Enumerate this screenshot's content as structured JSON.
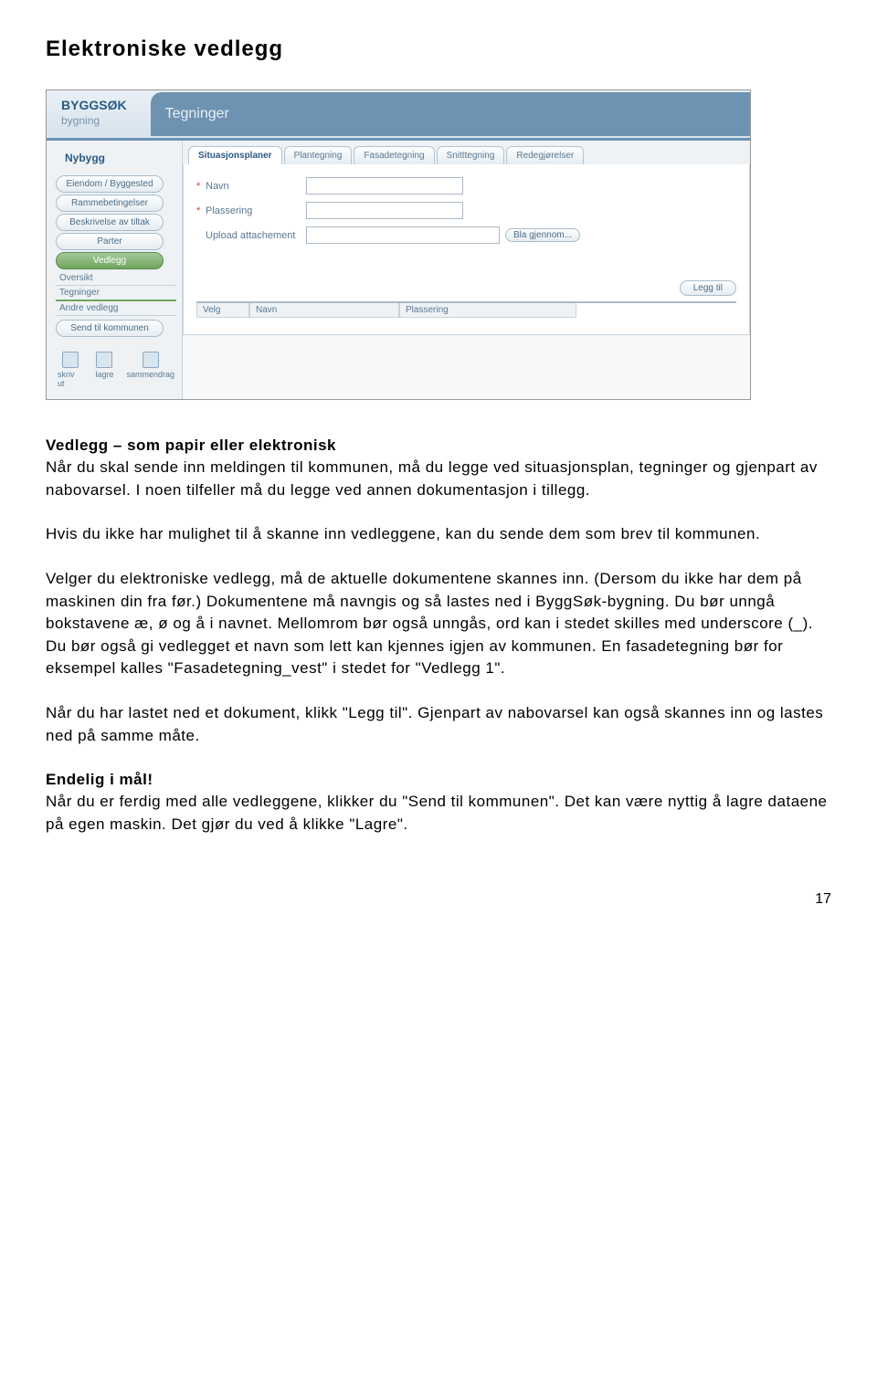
{
  "page": {
    "heading": "Elektroniske vedlegg",
    "number": "17"
  },
  "screenshot": {
    "logo": {
      "title": "BYGGSØK",
      "subtitle": "bygning"
    },
    "header_title": "Tegninger",
    "sidebar": {
      "category": "Nybygg",
      "buttons": [
        {
          "label": "Eiendom / Byggested",
          "active": false
        },
        {
          "label": "Rammebetingelser",
          "active": false
        },
        {
          "label": "Beskrivelse av tiltak",
          "active": false
        },
        {
          "label": "Parter",
          "active": false
        },
        {
          "label": "Vedlegg",
          "active": true
        }
      ],
      "subitems": [
        {
          "label": "Oversikt",
          "active": false
        },
        {
          "label": "Tegninger",
          "active": true
        },
        {
          "label": "Andre vedlegg",
          "active": false
        }
      ],
      "send_button": "Send til kommunen",
      "tools": [
        {
          "label": "skriv ut"
        },
        {
          "label": "lagre"
        },
        {
          "label": "sammendrag"
        }
      ]
    },
    "tabs": [
      {
        "label": "Situasjonsplaner",
        "active": true
      },
      {
        "label": "Plantegning",
        "active": false
      },
      {
        "label": "Fasadetegning",
        "active": false
      },
      {
        "label": "Snitttegning",
        "active": false
      },
      {
        "label": "Redegjørelser",
        "active": false
      }
    ],
    "form": {
      "navn_label": "Navn",
      "plassering_label": "Plassering",
      "upload_label": "Upload attachement",
      "browse_btn": "Bla gjennom...",
      "legg_til_btn": "Legg til",
      "grid_headers": {
        "velg": "Velg",
        "navn": "Navn",
        "plassering": "Plassering"
      }
    }
  },
  "text": {
    "h1": "Vedlegg – som papir eller elektronisk",
    "p1": "Når du skal sende inn meldingen til kommunen, må du legge ved situasjonsplan, tegninger og gjenpart av nabovarsel. I noen tilfeller må du legge ved annen dokumentasjon i tillegg.",
    "p2": "Hvis du ikke har mulighet til å skanne inn vedleggene, kan du sende dem som brev til kommunen.",
    "p3": "Velger du elektroniske vedlegg, må de aktuelle dokumentene skannes inn. (Dersom du ikke har dem på maskinen din fra før.) Dokumentene må navngis og så lastes ned i ByggSøk-bygning. Du bør unngå bokstavene æ, ø og å i navnet. Mellomrom bør også unngås, ord kan i stedet skilles med underscore (_). Du bør også gi vedlegget et navn som lett kan kjennes igjen av kommunen. En fasadetegning bør for eksempel kalles \"Fasadetegning_vest\" i stedet for \"Vedlegg 1\".",
    "p4": "Når du har lastet ned et dokument, klikk \"Legg til\". Gjenpart av nabovarsel kan også skannes inn og lastes ned på samme måte.",
    "h2": "Endelig i mål!",
    "p5": "Når du er ferdig med alle vedleggene, klikker du \"Send til kommunen\". Det kan være nyttig å lagre dataene på egen maskin. Det gjør du ved å klikke \"Lagre\"."
  }
}
